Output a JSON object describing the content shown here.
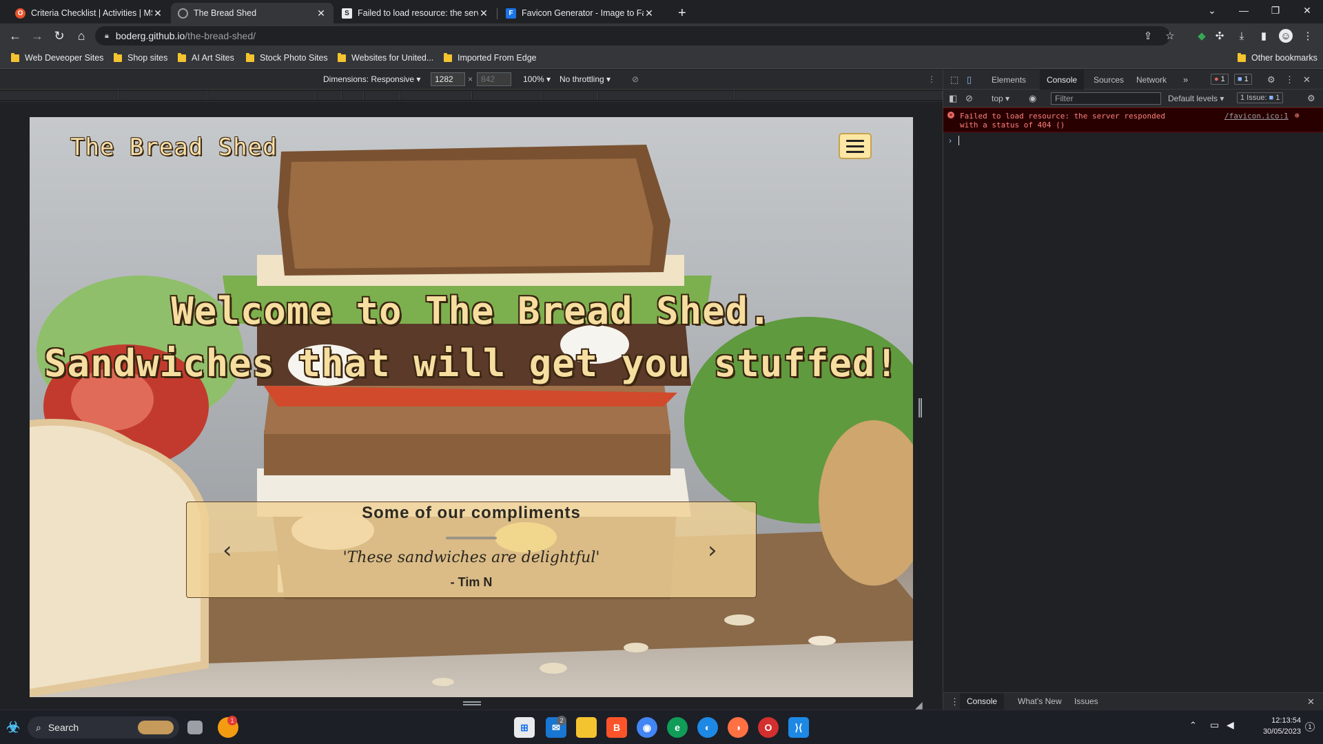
{
  "tabs": [
    {
      "title": "Criteria Checklist | Activities | MS",
      "favicon_color": "#e8542c",
      "favicon_glyph": "O"
    },
    {
      "title": "The Bread Shed",
      "favicon_color": "#5f6368",
      "favicon_glyph": "◎"
    },
    {
      "title": "Failed to load resource: the serve",
      "favicon_color": "#e8eaed",
      "favicon_glyph": "S"
    },
    {
      "title": "Favicon Generator - Image to Fav",
      "favicon_color": "#1a73e8",
      "favicon_glyph": "F"
    }
  ],
  "address": {
    "host": "boderg.github.io",
    "path": "/the-bread-shed/"
  },
  "bookmarks": [
    "Web Deveoper Sites",
    "Shop sites",
    "AI Art Sites",
    "Stock Photo Sites",
    "Websites for United...",
    "Imported From Edge"
  ],
  "other_bookmarks": "Other bookmarks",
  "device_toolbar": {
    "dimensions_label": "Dimensions: Responsive",
    "width": "1282",
    "height": "842",
    "zoom": "100%",
    "throttling": "No throttling"
  },
  "site": {
    "logo": "The Bread Shed",
    "hero_line1": "Welcome to The Bread Shed.",
    "hero_line2": "Sandwiches that will get you stuffed!",
    "carousel_title": "Some of our compliments",
    "quote": "'These sandwiches are delightful'",
    "author": "- Tim N"
  },
  "devtools": {
    "tabs": [
      "Elements",
      "Console",
      "Sources",
      "Network"
    ],
    "active_tab": "Console",
    "error_count": "1",
    "message_count": "1",
    "context": "top",
    "filter_placeholder": "Filter",
    "levels": "Default levels",
    "issues": "1 Issue:",
    "issue_count": "1",
    "error_message": "Failed to load resource: the server responded with a status of 404 ()",
    "error_source": "/favicon.ico:1",
    "drawer_tabs": [
      "Console",
      "What's New",
      "Issues"
    ]
  },
  "taskbar": {
    "search": "Search",
    "time": "12:13:54",
    "date": "30/05/2023",
    "notification_count": "1",
    "mail_badge": "2"
  },
  "colors": {
    "accent": "#f6dea0",
    "error": "#ff8080",
    "chrome_bg": "#202124"
  }
}
